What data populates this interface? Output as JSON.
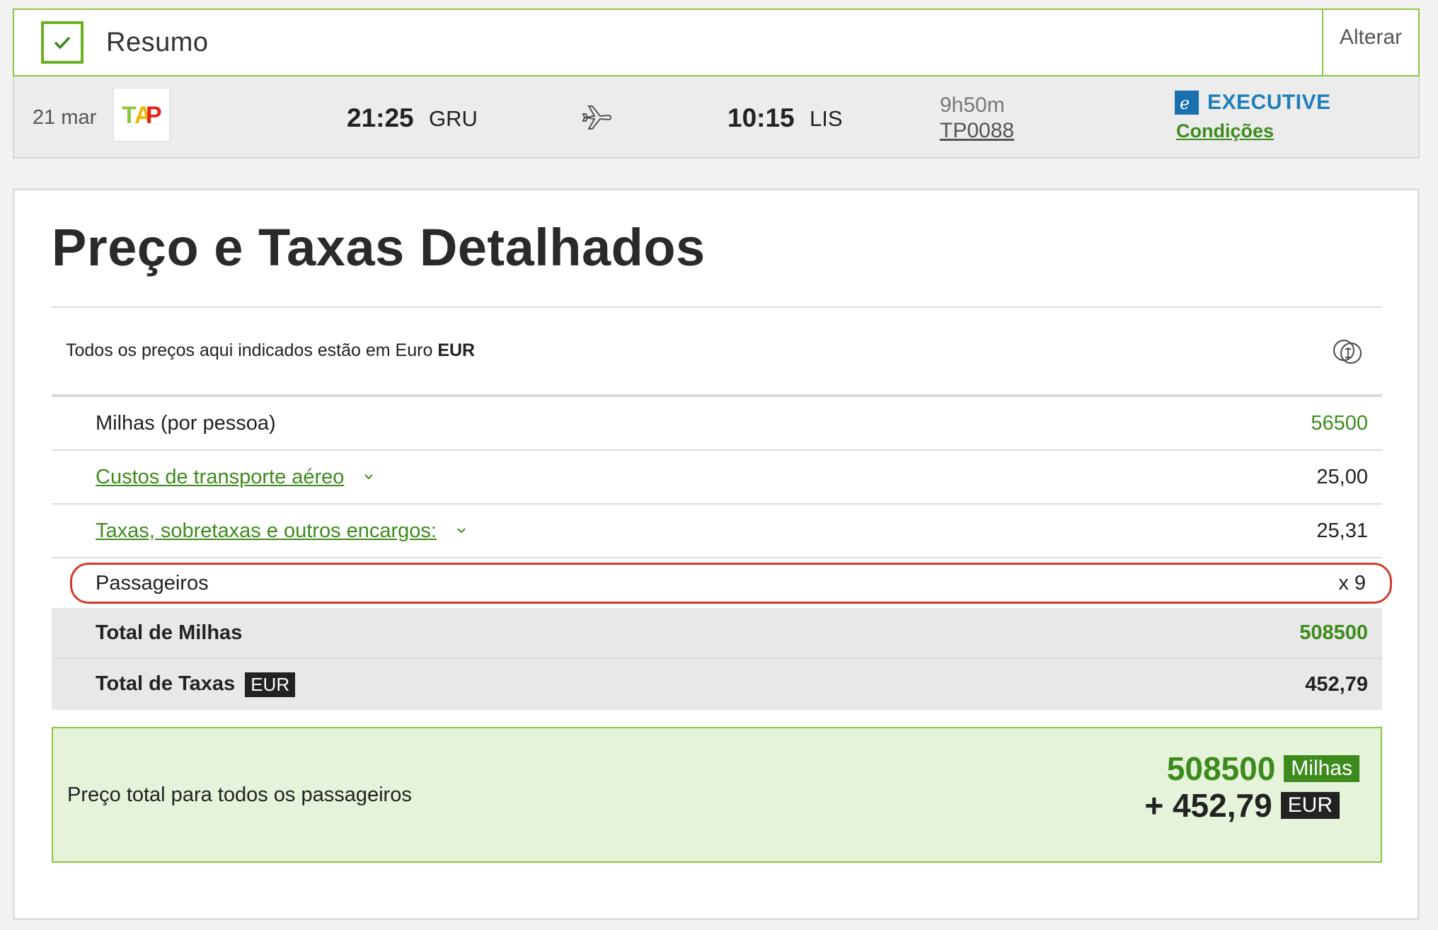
{
  "summary": {
    "title": "Resumo",
    "change_label": "Alterar"
  },
  "flight": {
    "date": "21 mar",
    "airline_logo_text": "TAP",
    "departure_time": "21:25",
    "departure_code": "GRU",
    "arrival_time": "10:15",
    "arrival_code": "LIS",
    "duration": "9h50m",
    "flight_number": "TP0088",
    "cabin": "EXECUTIVE",
    "conditions_label": "Condições"
  },
  "details": {
    "heading": "Preço e Taxas Detalhados",
    "currency_note_prefix": "Todos os preços aqui indicados estão em Euro",
    "currency_note_code": "EUR",
    "rows": [
      {
        "label": "Milhas (por pessoa)",
        "value": "56500"
      },
      {
        "label": "Custos de transporte aéreo",
        "value": "25,00"
      },
      {
        "label": "Taxas, sobretaxas e outros encargos:",
        "value": "25,31"
      },
      {
        "label": "Passageiros",
        "value": "x 9"
      }
    ],
    "total_miles_label": "Total de Milhas",
    "total_miles_value": "508500",
    "total_taxes_label": "Total de Taxas",
    "total_taxes_currency": "EUR",
    "total_taxes_value": "452,79"
  },
  "price_box": {
    "label": "Preço total para todos os passageiros",
    "miles_value": "508500",
    "miles_unit": "Milhas",
    "eur_value": "+ 452,79",
    "eur_unit": "EUR"
  },
  "colors": {
    "accent_green": "#3d8b1c",
    "border_green": "#8cc63f",
    "executive_blue": "#1f7fb8",
    "highlight_red": "#d43a2e"
  },
  "icons": {
    "check": "check-icon",
    "plane": "plane-icon",
    "currency": "currency-exchange-icon",
    "chevron": "chevron-down-icon",
    "executive": "executive-e-icon"
  }
}
